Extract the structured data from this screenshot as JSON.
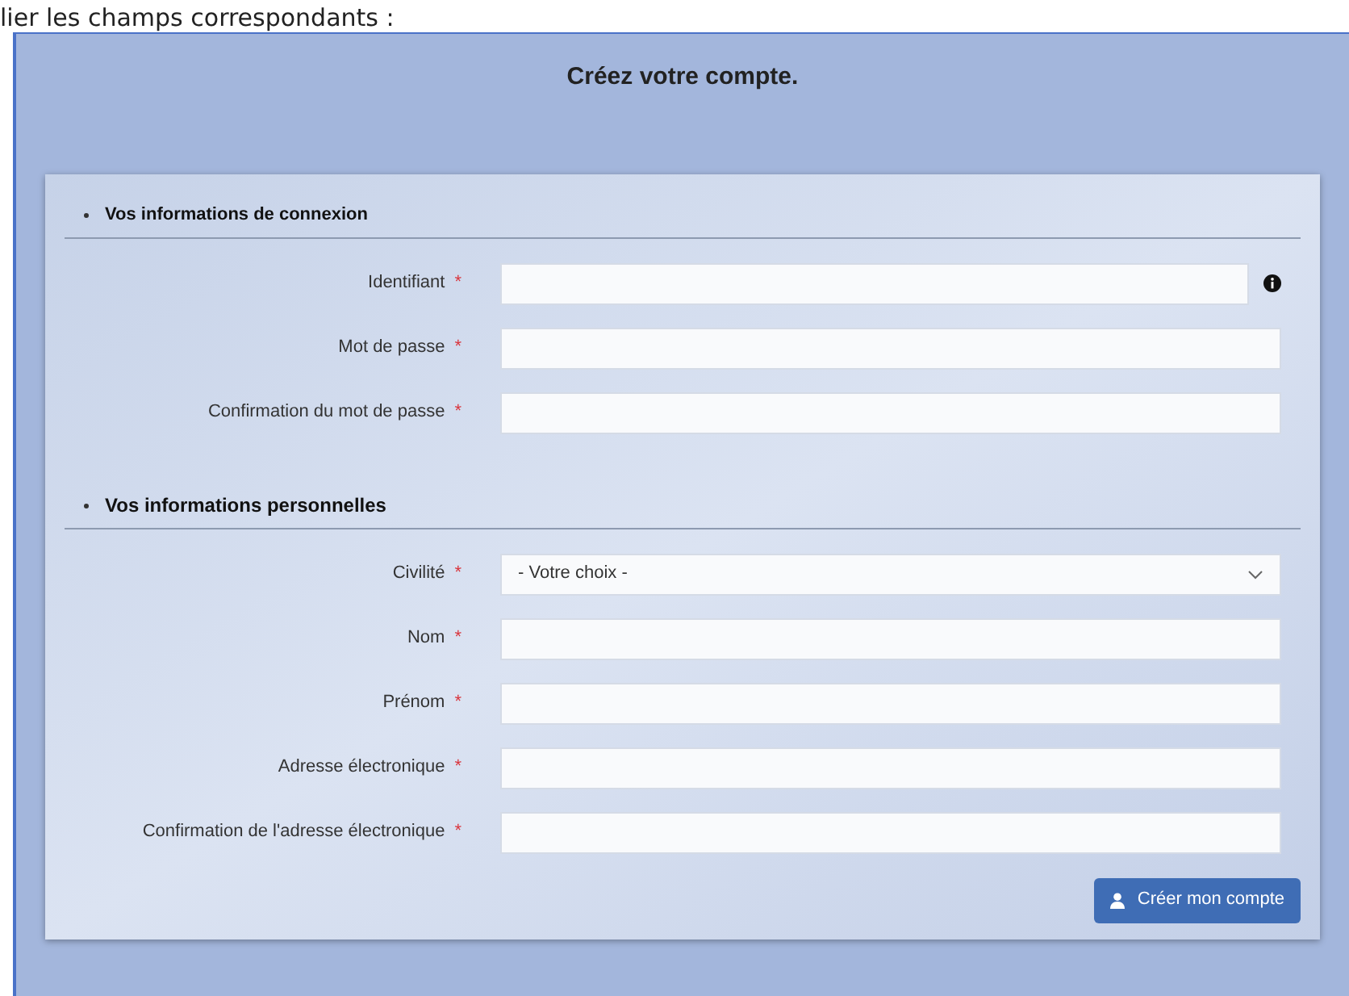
{
  "document_text": "lier les champs correspondants :",
  "page": {
    "title": "Créez votre compte."
  },
  "sections": [
    {
      "title": "Vos informations de connexion",
      "fields": [
        {
          "kind": "text",
          "label": "Identifiant",
          "required": true,
          "info": true
        },
        {
          "kind": "text",
          "label": "Mot de passe",
          "required": true,
          "info": false
        },
        {
          "kind": "text",
          "label": "Confirmation du mot de passe",
          "required": true,
          "info": false
        }
      ]
    },
    {
      "title": "Vos informations personnelles",
      "fields": [
        {
          "kind": "select",
          "label": "Civilité",
          "required": true,
          "info": false,
          "value": "- Votre choix -"
        },
        {
          "kind": "text",
          "label": "Nom",
          "required": true,
          "info": false
        },
        {
          "kind": "text",
          "label": "Prénom",
          "required": true,
          "info": false
        },
        {
          "kind": "text",
          "label": "Adresse électronique",
          "required": true,
          "info": false
        },
        {
          "kind": "text",
          "label": "Confirmation de l'adresse électronique",
          "required": true,
          "info": false
        }
      ]
    }
  ],
  "required_mark": "*",
  "submit": {
    "label": "Créer mon compte"
  }
}
